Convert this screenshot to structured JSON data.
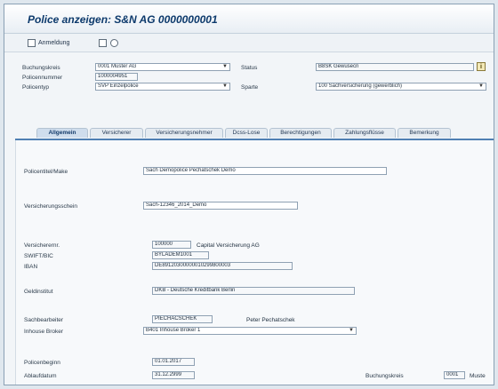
{
  "window": {
    "title": "Police anzeigen: S&N AG 0000000001"
  },
  "toolbar": {
    "anmeldung_label": "Anmeldung"
  },
  "header": {
    "buchungskreis": {
      "label": "Buchungskreis",
      "value": "0001 Muster AG"
    },
    "policennummer": {
      "label": "Policennummer",
      "value": "1000004951"
    },
    "policentyp": {
      "label": "Policentyp",
      "value": "SVP Einzelpolice"
    },
    "status": {
      "label": "Status",
      "value": "B8SK Gewusecn"
    },
    "sparte": {
      "label": "Sparte",
      "value": "100 Sachversicherung (gewerblich)"
    },
    "info_icon": "info-icon"
  },
  "tabs": [
    {
      "label": "Allgemein",
      "active": true
    },
    {
      "label": "Versicherer",
      "active": false
    },
    {
      "label": "Versicherungsnehmer",
      "active": false
    },
    {
      "label": "Dcss-Lose",
      "active": false
    },
    {
      "label": "Berechtigungen",
      "active": false
    },
    {
      "label": "Zahlungsflüsse",
      "active": false
    },
    {
      "label": "Bemerkung",
      "active": false
    }
  ],
  "general": {
    "policentitel": {
      "label": "Policentitel/Make",
      "value": "Sach Demopolice Pechatschek Demo"
    },
    "versicherungsschein": {
      "label": "Versicherungsschein",
      "value": "Sach-12346_2014_Demo"
    },
    "versicherer": {
      "label": "Versicherernr.",
      "value": "100000",
      "name": "Capital Versicherung AG"
    },
    "swift": {
      "label": "SWIFT/BIC",
      "value": "BYLADEM1001"
    },
    "iban": {
      "label": "IBAN",
      "value": "DE89120300000010299800003"
    },
    "geldinstitut": {
      "label": "Geldinstitut",
      "value": "DKB - Deutsche Kreditbank Berlin"
    },
    "sachbearbeiter": {
      "label": "Sachbearbeiter",
      "value": "PIECHACSCHEK",
      "name": "Peter Pechatschek"
    },
    "inhouse_broker": {
      "label": "Inhouse Broker",
      "value": "B401 Inhouse Broker 1"
    },
    "policenbeginn": {
      "label": "Policenbeginn",
      "value": "01.01.2017"
    },
    "ablaufdatum": {
      "label": "Ablaufdatum",
      "value": "31.12.2999"
    },
    "buchungskreis2": {
      "label": "Buchungskreis",
      "value": "0001",
      "name": "Muste"
    }
  }
}
